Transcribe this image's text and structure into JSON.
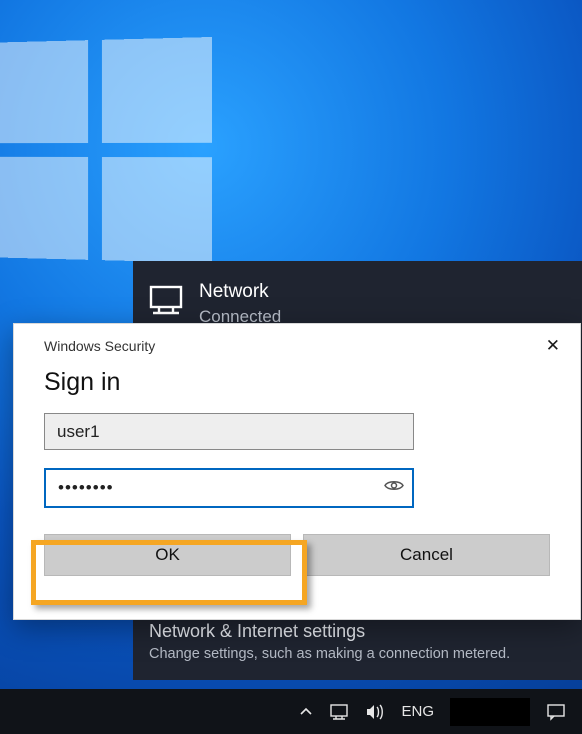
{
  "network_panel": {
    "title": "Network",
    "status": "Connected",
    "settings_title": "Network & Internet settings",
    "settings_sub": "Change settings, such as making a connection metered."
  },
  "credential_dialog": {
    "titlebar": "Windows Security",
    "heading": "Sign in",
    "username_value": "user1",
    "password_value": "••••••••",
    "ok_label": "OK",
    "cancel_label": "Cancel"
  },
  "taskbar": {
    "language": "ENG"
  },
  "colors": {
    "accent": "#0067c0",
    "highlight": "#f5a623"
  }
}
